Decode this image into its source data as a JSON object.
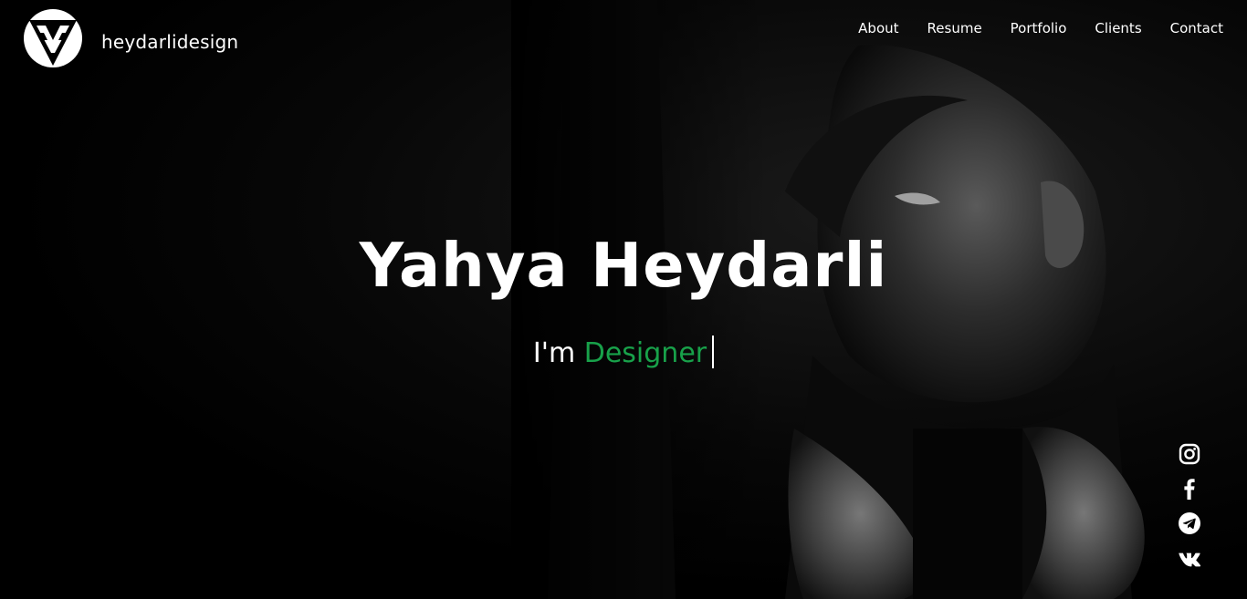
{
  "header": {
    "brand": "heydarlidesign",
    "nav": [
      {
        "label": "About"
      },
      {
        "label": "Resume"
      },
      {
        "label": "Portfolio"
      },
      {
        "label": "Clients"
      },
      {
        "label": "Contact"
      }
    ]
  },
  "hero": {
    "name": "Yahya Heydarli",
    "tagline_prefix": "I'm ",
    "tagline_role": "Designer"
  },
  "social": [
    {
      "icon": "instagram-icon"
    },
    {
      "icon": "facebook-icon"
    },
    {
      "icon": "telegram-icon"
    },
    {
      "icon": "vk-icon"
    }
  ],
  "colors": {
    "background": "#000000",
    "accent": "#18a14a",
    "text": "#ffffff"
  }
}
